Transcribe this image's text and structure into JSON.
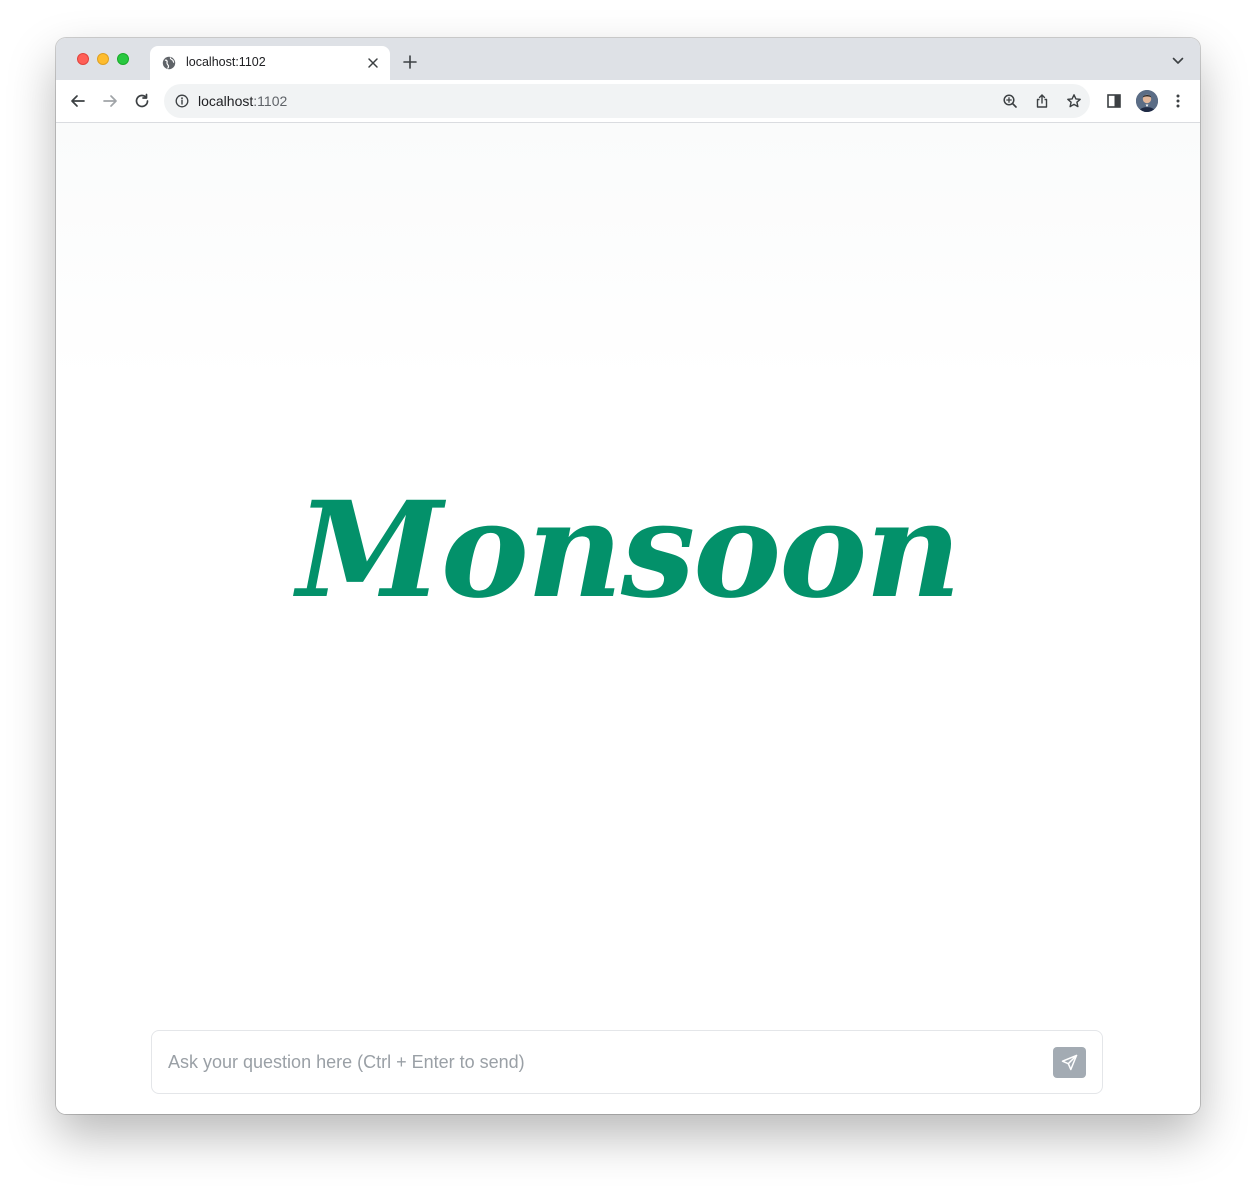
{
  "browser": {
    "tab": {
      "title": "localhost:1102",
      "favicon": "globe-icon"
    },
    "address": {
      "host": "localhost",
      "port": ":1102"
    },
    "icons": {
      "back": "arrow-left-icon",
      "forward": "arrow-right-icon",
      "reload": "reload-icon",
      "info": "info-icon",
      "zoom": "zoom-icon",
      "share": "share-icon",
      "bookmark": "star-icon",
      "side_panel": "side-panel-icon",
      "menu": "kebab-menu-icon",
      "new_tab": "plus-icon",
      "tab_search": "chevron-down-icon",
      "close_tab": "close-icon"
    }
  },
  "app": {
    "logo_text": "Monsoon",
    "brand_color": "#03916a",
    "chat": {
      "placeholder": "Ask your question here (Ctrl + Enter to send)",
      "value": "",
      "send_icon": "send-icon"
    }
  }
}
